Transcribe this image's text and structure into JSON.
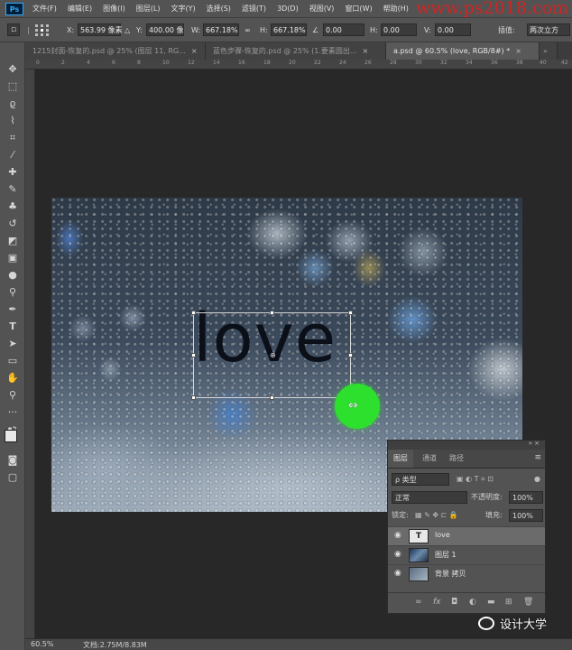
{
  "app": {
    "logo": "Ps"
  },
  "menu": [
    "文件(F)",
    "编辑(E)",
    "图像(I)",
    "图层(L)",
    "文字(Y)",
    "选择(S)",
    "滤镜(T)",
    "3D(D)",
    "视图(V)",
    "窗口(W)",
    "帮助(H)"
  ],
  "watermark": "www.ps2018.com",
  "options": {
    "x_label": "X:",
    "x_value": "563.99 像素",
    "y_label": "Y:",
    "y_value": "400.00 像",
    "w_label": "W:",
    "w_value": "667.18%",
    "h_label": "H:",
    "h_value": "667.18%",
    "angle_value": "0.00",
    "hskew_label": "H:",
    "hskew_value": "0.00",
    "vskew_label": "V:",
    "vskew_value": "0.00",
    "interp_label": "插值:",
    "interp_value": "两次立方"
  },
  "tabs": [
    {
      "label": "1215封面-恢复的.psd @ 25% (图层 11, RG...",
      "close": "×"
    },
    {
      "label": "蓝色步骤-恢复的.psd @ 25% (1.要素圆出...",
      "close": "×"
    },
    {
      "label": "a.psd @ 60.5% (love, RGB/8#) *",
      "close": "×"
    }
  ],
  "ruler": [
    "0",
    "2",
    "4",
    "6",
    "8",
    "10",
    "12",
    "14",
    "16",
    "18",
    "20",
    "22",
    "24",
    "26",
    "28",
    "30",
    "32",
    "34",
    "36",
    "38",
    "40",
    "42"
  ],
  "canvas_text": "love",
  "layers_panel": {
    "tabs": [
      "图层",
      "通道",
      "路径"
    ],
    "search_placeholder": "ρ 类型",
    "blend_mode": "正常",
    "opacity_label": "不透明度:",
    "opacity_value": "100%",
    "lock_label": "锁定:",
    "fill_label": "填充:",
    "fill_value": "100%",
    "layers": [
      {
        "name": "love",
        "thumb": "T",
        "selected": true
      },
      {
        "name": "图层 1",
        "thumb": "",
        "selected": false
      },
      {
        "name": "背景 拷贝",
        "thumb": "",
        "selected": false
      }
    ]
  },
  "status": {
    "zoom": "60.5%",
    "doc": "文档:2.75M/8.83M"
  },
  "wechat_name": "设计大学"
}
